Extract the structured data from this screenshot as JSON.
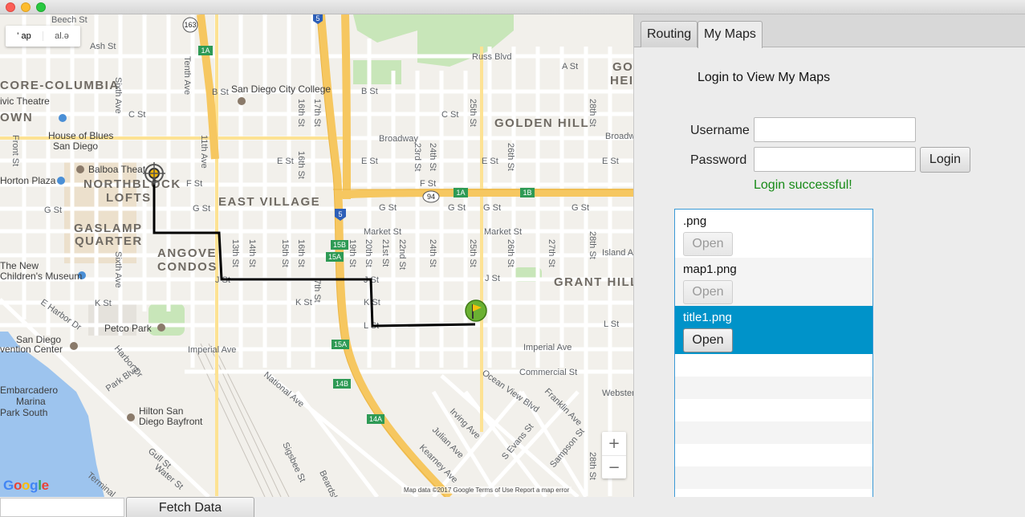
{
  "window": {
    "controls": [
      "close",
      "minimize",
      "maximize"
    ]
  },
  "map": {
    "mode_buttons": [
      "Map",
      "Satellite"
    ],
    "mode_buttons_shown": [
      "' ap",
      "al.ǝ"
    ],
    "zoom_in": "+",
    "zoom_out": "−",
    "logo": "Google",
    "attribution": "Map data ©2017 Google   Terms of Use   Report a map error",
    "districts": [
      "CORE-COLUMBIA",
      "OWN",
      "NORTHBLOCK",
      "LOFTS",
      "GASLAMP",
      "QUARTER",
      "EAST VILLAGE",
      "ANGOVE",
      "CONDOS",
      "GOLDEN HILL",
      "GRANT HILL",
      "GO",
      "HEI"
    ],
    "pois": [
      "San Diego City College",
      "House of Blues",
      "San Diego",
      "Balboa Theat",
      "Horton Plaza",
      "The New",
      "Children's Museum",
      "Petco Park",
      "San Diego",
      "vention Center",
      "Embarcadero",
      "Marina",
      "Park South",
      "Hilton San",
      "Diego Bayfront",
      "ivic Theatre"
    ],
    "streets": [
      "Ash St",
      "Beech St",
      "A St",
      "B St",
      "C St",
      "Broadway",
      "E St",
      "F St",
      "G St",
      "Market St",
      "J St",
      "K St",
      "L St",
      "Imperial Ave",
      "Commercial St",
      "National Ave",
      "Russ Blvd",
      "Tenth Ave",
      "11th Ave",
      "Sixth Ave",
      "Front St",
      "16th St",
      "17th St",
      "19th St",
      "20th St",
      "21st St",
      "22nd St",
      "23rd St",
      "24th St",
      "25th St",
      "26th St",
      "27th St",
      "28th St",
      "13th St",
      "14th St",
      "15th St",
      "7th St",
      "Ocean View Blvd",
      "Franklin Ave",
      "Irving Ave",
      "Julian Ave",
      "Kearney Ave",
      "S Evans St",
      "Sampson St",
      "Sigsbee St",
      "Beardsley St",
      "Harbor Dr",
      "E Harbor Dr",
      "Park Blvd",
      "Gull St",
      "Water St",
      "Terminal",
      "Island Ave",
      "Webster",
      "Broadw"
    ],
    "shields": [
      "163",
      "5",
      "1A",
      "1B",
      "94",
      "5",
      "15B",
      "15A",
      "15A",
      "14B",
      "14A"
    ]
  },
  "tabs": [
    {
      "label": "Routing",
      "active": false
    },
    {
      "label": "My Maps",
      "active": true
    }
  ],
  "login": {
    "title": "Login to View My Maps",
    "username_label": "Username",
    "username_value": "",
    "password_label": "Password",
    "password_value": "",
    "login_button": "Login",
    "status": "Login successful!",
    "status_color": "#178a17"
  },
  "maps_list": {
    "items": [
      {
        "title": ".png",
        "button": "Open",
        "selected": false
      },
      {
        "title": "map1.png",
        "button": "Open",
        "selected": false
      },
      {
        "title": "title1.png",
        "button": "Open",
        "selected": true
      }
    ],
    "selection_color": "#0093c9"
  },
  "bottom": {
    "input_value": "",
    "fetch_button": "Fetch Data"
  },
  "colors": {
    "route": "#000000",
    "highway": "#f6c760",
    "park": "#c8e6b9",
    "water": "#9dc4ee"
  }
}
